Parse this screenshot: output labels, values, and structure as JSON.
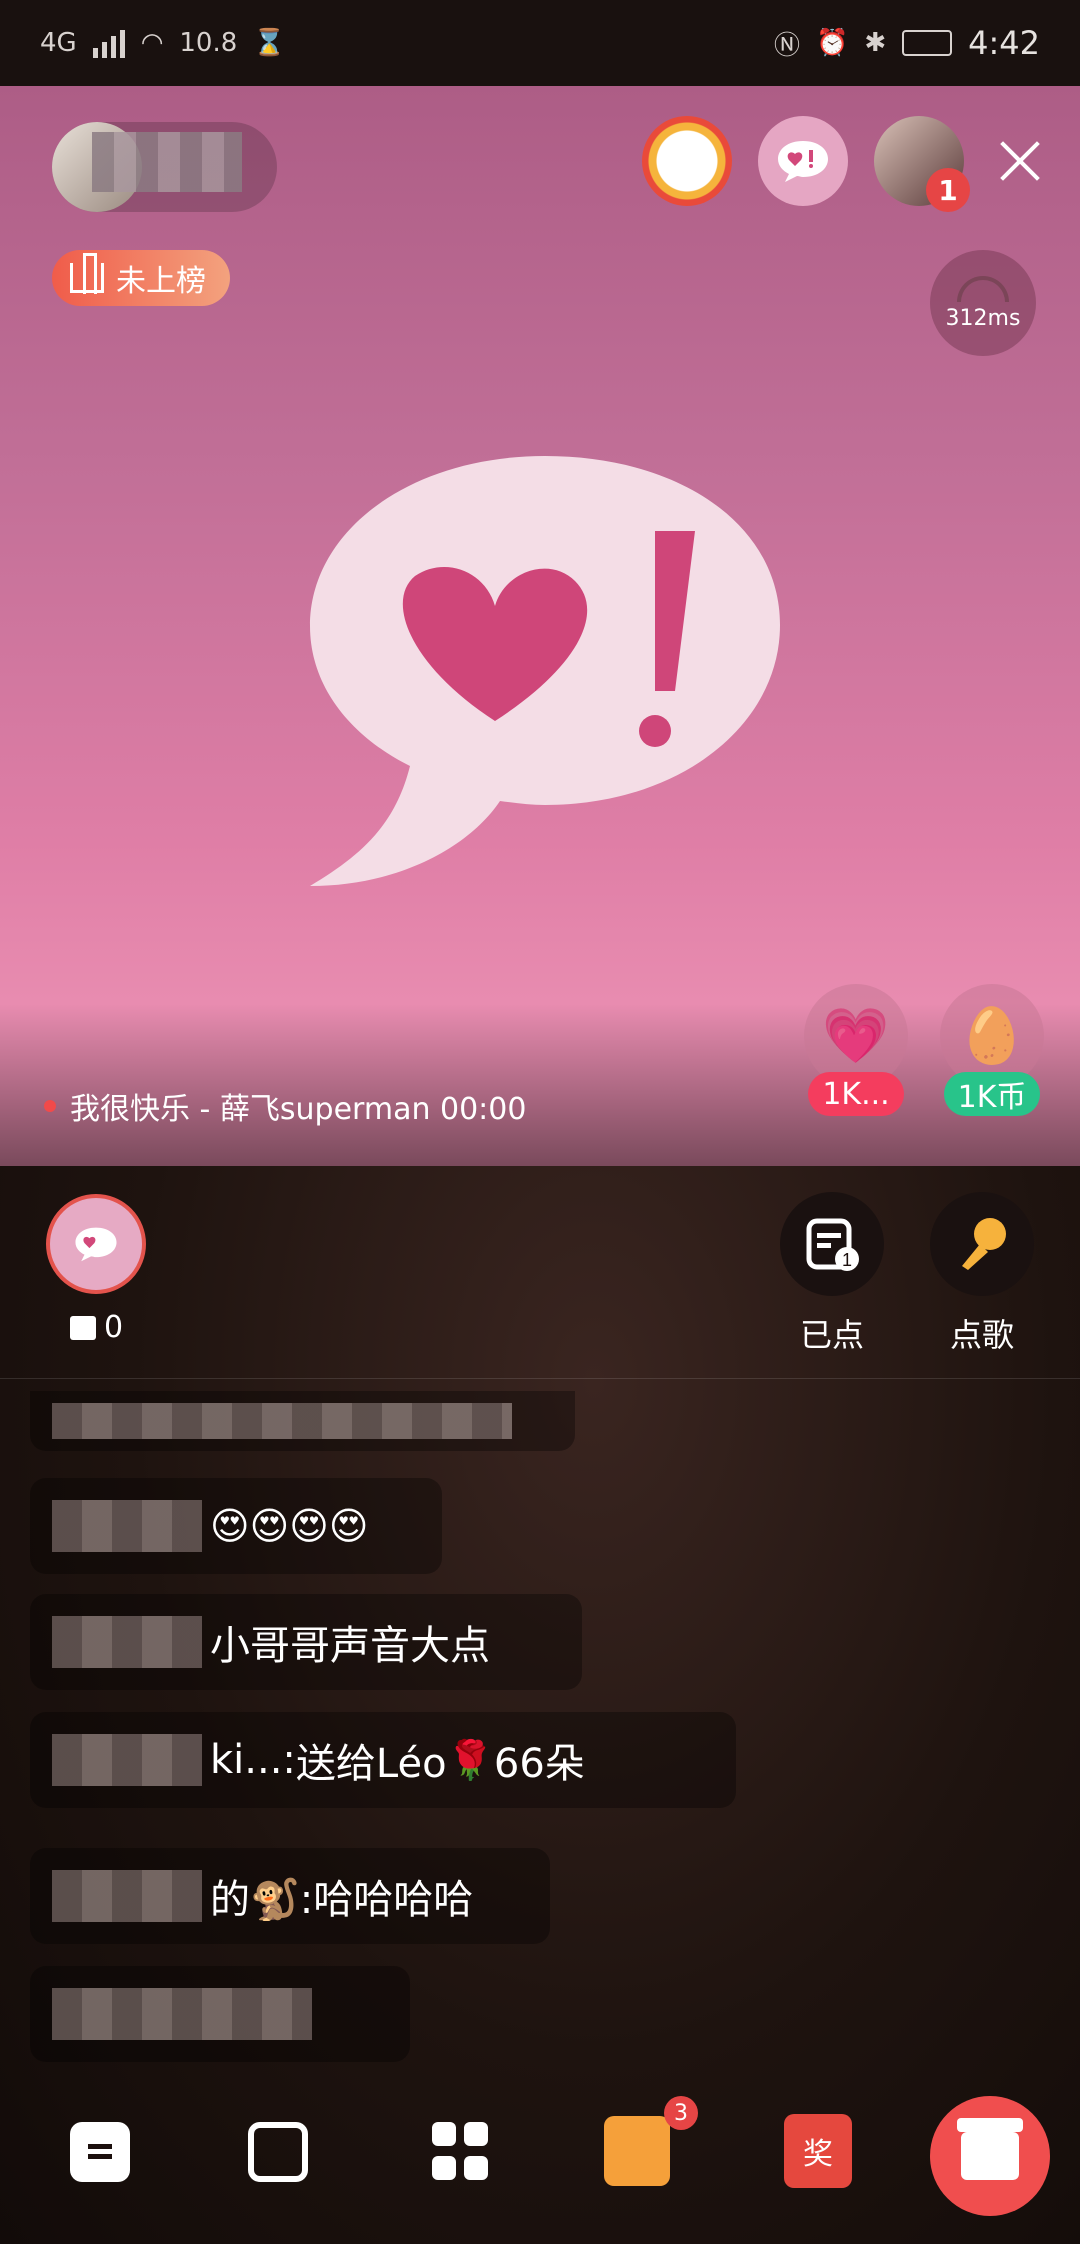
{
  "status_bar": {
    "network": "4G",
    "speed": "10.8",
    "time": "4:42"
  },
  "header": {
    "rank_label": "未上榜",
    "ping": "312ms",
    "viewer_badge_count": "1"
  },
  "now_playing": "我很快乐 - 薛飞superman 00:00",
  "gift_chips": [
    {
      "label": "1K...",
      "color": "#f43d5e"
    },
    {
      "label": "1K币",
      "color": "#28c48a"
    }
  ],
  "self": {
    "gift_count": "0"
  },
  "actions": {
    "ordered_label": "已点",
    "ordered_badge": "1",
    "request_label": "点歌"
  },
  "chat": [
    {
      "name_w": 0,
      "text": ""
    },
    {
      "text": "😍😍😍😍"
    },
    {
      "text": "小哥哥声音大点"
    },
    {
      "prefix": "ki...: ",
      "text": "送给Léo ",
      "emoji": "🌹",
      "suffix": " 66朵"
    },
    {
      "prefix": "的🐒: ",
      "text": "哈哈哈哈"
    },
    {
      "text": ""
    }
  ],
  "bottom_bar": {
    "task_badge": "3",
    "lottery_label": "奖"
  }
}
